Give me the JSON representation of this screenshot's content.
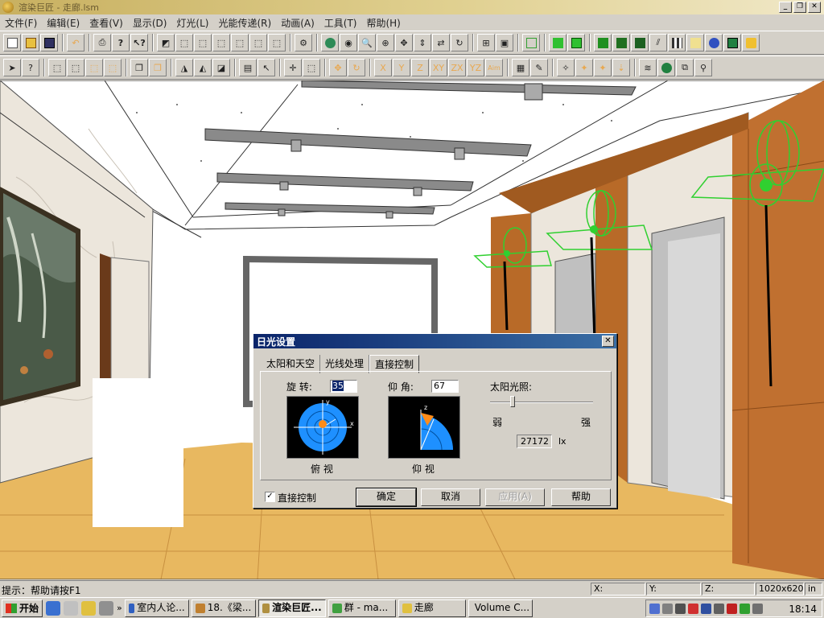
{
  "window": {
    "title": "渲染巨匠 - 走廊.lsm"
  },
  "menu": [
    {
      "label": "文件(F)"
    },
    {
      "label": "编辑(E)"
    },
    {
      "label": "查看(V)"
    },
    {
      "label": "显示(D)"
    },
    {
      "label": "灯光(L)"
    },
    {
      "label": "光能传递(R)"
    },
    {
      "label": "动画(A)"
    },
    {
      "label": "工具(T)"
    },
    {
      "label": "帮助(H)"
    }
  ],
  "toolbar2_axis": [
    "X",
    "Y",
    "Z",
    "XY",
    "ZX",
    "YZ",
    "Aim"
  ],
  "dialog": {
    "title": "日光设置",
    "tabs": [
      {
        "label": "太阳和天空",
        "active": false
      },
      {
        "label": "光线处理",
        "active": false
      },
      {
        "label": "直接控制",
        "active": true
      }
    ],
    "rotation_label": "旋  转:",
    "rotation_value": "35",
    "elevation_label": "仰  角:",
    "elevation_value": "67",
    "top_view_label": "俯 视",
    "elevation_view_label": "仰 视",
    "sunlight_label": "太阳光照:",
    "weak_label": "弱",
    "strong_label": "强",
    "sunlight_level": 0.22,
    "lux_value": "27172",
    "lux_unit": "lx",
    "direct_control_label": "直接控制",
    "direct_control_checked": true,
    "buttons": {
      "ok": "确定",
      "cancel": "取消",
      "apply": "应用(A)",
      "help": "帮助"
    },
    "dial_colors": {
      "bg": "#000000",
      "disc": "#1e90ff",
      "sun": "#ff8c1a",
      "axis": "#ffffff"
    }
  },
  "dial_axes": {
    "top_y": "y",
    "top_x": "x",
    "elev_z": "z"
  },
  "statusbar": {
    "hint": "提示：帮助请按F1",
    "x_label": "X:",
    "y_label": "Y:",
    "z_label": "Z:",
    "resolution": "1020x620",
    "unit": "in"
  },
  "taskbar": {
    "start_label": "开始",
    "tasks": [
      {
        "label": "室内人论...",
        "active": false,
        "color": "#3060c0"
      },
      {
        "label": "18.《梁...",
        "active": false,
        "color": "#c08030"
      },
      {
        "label": "渲染巨匠...",
        "active": true,
        "color": "#b09040"
      },
      {
        "label": "群 - ma...",
        "active": false,
        "color": "#40a040"
      },
      {
        "label": "走廊",
        "active": false,
        "color": "#e0c040"
      },
      {
        "label": "Volume C...",
        "active": false,
        "color": "#808080"
      }
    ],
    "clock": "18:14"
  }
}
